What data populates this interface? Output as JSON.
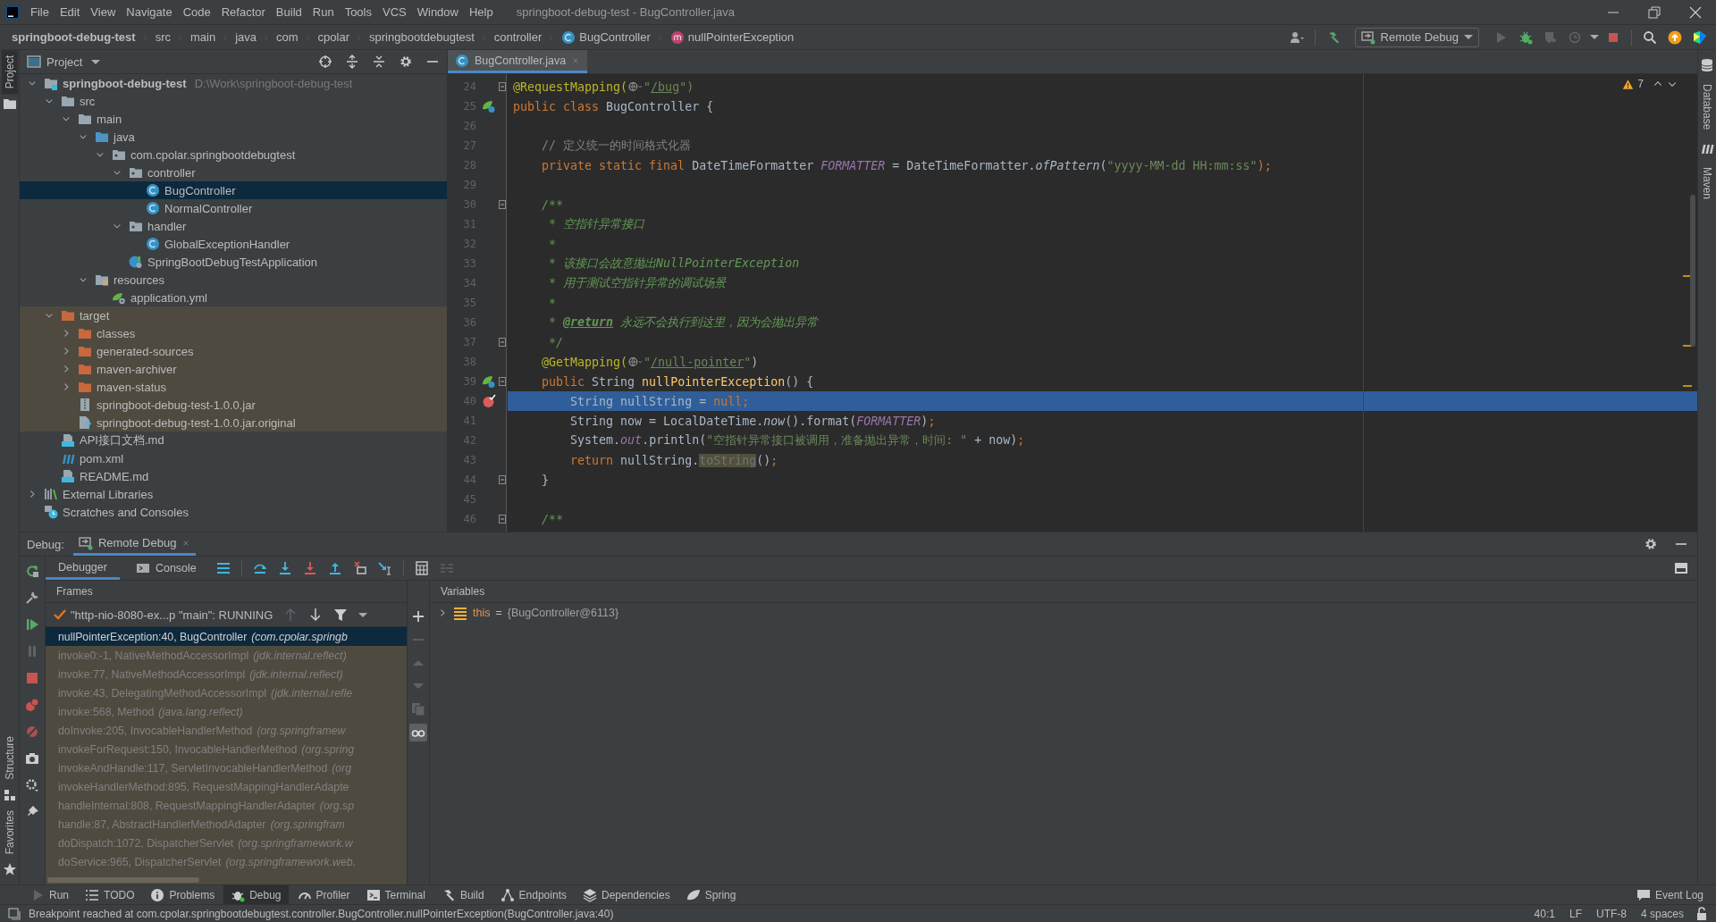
{
  "window": {
    "title": "springboot-debug-test - BugController.java"
  },
  "menu": [
    "File",
    "Edit",
    "View",
    "Navigate",
    "Code",
    "Refactor",
    "Build",
    "Run",
    "Tools",
    "VCS",
    "Window",
    "Help"
  ],
  "breadcrumbs": [
    {
      "label": "springboot-debug-test",
      "kind": "project"
    },
    {
      "label": "src",
      "kind": "folder"
    },
    {
      "label": "main",
      "kind": "folder"
    },
    {
      "label": "java",
      "kind": "folder"
    },
    {
      "label": "com",
      "kind": "folder"
    },
    {
      "label": "cpolar",
      "kind": "folder"
    },
    {
      "label": "springbootdebugtest",
      "kind": "folder"
    },
    {
      "label": "controller",
      "kind": "folder"
    },
    {
      "label": "BugController",
      "kind": "class"
    },
    {
      "label": "nullPointerException",
      "kind": "method"
    }
  ],
  "run_config": {
    "label": "Remote Debug"
  },
  "left_stripe": [
    {
      "label": "Project",
      "selected": true
    },
    {
      "label": "Structure",
      "selected": false
    },
    {
      "label": "Favorites",
      "selected": false
    }
  ],
  "right_stripe": [
    {
      "label": "Database",
      "kind": "database"
    },
    {
      "label": "Maven",
      "kind": "maven"
    }
  ],
  "project_panel": {
    "title": "Project",
    "tree": [
      {
        "name": "springboot-debug-test",
        "path": "D:\\Work\\springboot-debug-test",
        "kind": "module",
        "expanded": true,
        "selected": false,
        "children": [
          {
            "name": "src",
            "kind": "folder",
            "expanded": true,
            "selected": false,
            "excluded": false,
            "children": [
              {
                "name": "main",
                "kind": "folder",
                "expanded": true,
                "selected": false,
                "children": [
                  {
                    "name": "java",
                    "kind": "source-root",
                    "expanded": true,
                    "selected": false,
                    "children": [
                      {
                        "name": "com.cpolar.springbootdebugtest",
                        "kind": "package",
                        "expanded": true,
                        "selected": false,
                        "children": [
                          {
                            "name": "controller",
                            "kind": "package",
                            "expanded": true,
                            "selected": false,
                            "children": [
                              {
                                "name": "BugController",
                                "kind": "class",
                                "selected": true
                              },
                              {
                                "name": "NormalController",
                                "kind": "class",
                                "selected": false
                              }
                            ]
                          },
                          {
                            "name": "handler",
                            "kind": "package",
                            "expanded": true,
                            "selected": false,
                            "children": [
                              {
                                "name": "GlobalExceptionHandler",
                                "kind": "class",
                                "selected": false
                              }
                            ]
                          },
                          {
                            "name": "SpringBootDebugTestApplication",
                            "kind": "spring-app",
                            "selected": false
                          }
                        ]
                      }
                    ]
                  },
                  {
                    "name": "resources",
                    "kind": "resources-root",
                    "expanded": true,
                    "selected": false,
                    "children": [
                      {
                        "name": "application.yml",
                        "kind": "yml",
                        "selected": false
                      }
                    ]
                  }
                ]
              }
            ]
          },
          {
            "name": "target",
            "kind": "excluded-folder",
            "expanded": true,
            "selected": false,
            "excluded": true,
            "children": [
              {
                "name": "classes",
                "kind": "excluded-folder",
                "expanded": false,
                "selected": false
              },
              {
                "name": "generated-sources",
                "kind": "excluded-folder",
                "expanded": false,
                "selected": false
              },
              {
                "name": "maven-archiver",
                "kind": "excluded-folder",
                "expanded": false,
                "selected": false
              },
              {
                "name": "maven-status",
                "kind": "excluded-folder",
                "expanded": false,
                "selected": false
              },
              {
                "name": "springboot-debug-test-1.0.0.jar",
                "kind": "jar",
                "selected": false
              },
              {
                "name": "springboot-debug-test-1.0.0.jar.original",
                "kind": "unknown",
                "selected": false
              }
            ]
          },
          {
            "name": "API接口文档.md",
            "kind": "markdown",
            "selected": false,
            "excluded": false
          },
          {
            "name": "pom.xml",
            "kind": "maven",
            "selected": false,
            "excluded": false
          },
          {
            "name": "README.md",
            "kind": "markdown",
            "selected": false,
            "excluded": false
          }
        ]
      },
      {
        "name": "External Libraries",
        "kind": "libraries",
        "expanded": false,
        "selected": false
      },
      {
        "name": "Scratches and Consoles",
        "kind": "scratches",
        "selected": false
      }
    ]
  },
  "editor": {
    "tabs": [
      {
        "label": "BugController.java",
        "selected": true
      }
    ],
    "warnings": "7",
    "lines": [
      {
        "number": "24",
        "fold": true,
        "current": false,
        "tokens": [
          {
            "text": "@RequestMapping(",
            "kind": "ann"
          },
          {
            "kind": "globe"
          },
          {
            "text": "\"",
            "kind": "str"
          },
          {
            "text": "/bug",
            "kind": "link"
          },
          {
            "text": "\")",
            "kind": "str"
          }
        ]
      },
      {
        "number": "25",
        "runnable": true,
        "fold": false,
        "current": false,
        "tokens": [
          {
            "text": "public class ",
            "kind": "kw"
          },
          {
            "text": "BugController {",
            "kind": "plain"
          }
        ]
      },
      {
        "number": "26",
        "fold": false,
        "current": false
      },
      {
        "number": "27",
        "fold": false,
        "current": false,
        "tokens": [
          {
            "text": "    // 定义统一的时间格式化器",
            "kind": "com"
          }
        ]
      },
      {
        "number": "28",
        "fold": false,
        "current": false,
        "tokens": [
          {
            "text": "    private static final ",
            "kind": "kw"
          },
          {
            "text": "DateTimeFormatter ",
            "kind": "plain"
          },
          {
            "text": "FORMATTER",
            "kind": "field"
          },
          {
            "text": " = DateTimeFormatter.",
            "kind": "plain"
          },
          {
            "text": "ofPattern",
            "kind": "italic"
          },
          {
            "text": "(",
            "kind": "plain"
          },
          {
            "text": "\"yyyy-MM-dd HH:mm:ss\"",
            "kind": "str"
          },
          {
            "text": ");",
            "kind": "kw"
          }
        ]
      },
      {
        "number": "29",
        "fold": false,
        "current": false
      },
      {
        "number": "30",
        "fold": true,
        "current": false,
        "tokens": [
          {
            "text": "    /**",
            "kind": "doc"
          }
        ]
      },
      {
        "number": "31",
        "fold": false,
        "current": false,
        "tokens": [
          {
            "text": "     * 空指针异常接口",
            "kind": "doc"
          }
        ]
      },
      {
        "number": "32",
        "fold": false,
        "current": false,
        "tokens": [
          {
            "text": "     *",
            "kind": "doc"
          }
        ]
      },
      {
        "number": "33",
        "fold": false,
        "current": false,
        "tokens": [
          {
            "text": "     * 该接口会故意抛出NullPointerException",
            "kind": "doc"
          }
        ]
      },
      {
        "number": "34",
        "fold": false,
        "current": false,
        "tokens": [
          {
            "text": "     * 用于测试空指针异常的调试场景",
            "kind": "doc"
          }
        ]
      },
      {
        "number": "35",
        "fold": false,
        "current": false,
        "tokens": [
          {
            "text": "     *",
            "kind": "doc"
          }
        ]
      },
      {
        "number": "36",
        "fold": false,
        "current": false,
        "tokens": [
          {
            "text": "     * ",
            "kind": "doc"
          },
          {
            "text": "@return",
            "kind": "doctag"
          },
          {
            "text": " 永远不会执行到这里，因为会抛出异常",
            "kind": "doc"
          }
        ]
      },
      {
        "number": "37",
        "fold": true,
        "current": false,
        "tokens": [
          {
            "text": "     */",
            "kind": "doc"
          }
        ]
      },
      {
        "number": "38",
        "fold": false,
        "current": false,
        "tokens": [
          {
            "text": "    @GetMapping(",
            "kind": "ann"
          },
          {
            "kind": "globe"
          },
          {
            "text": "\"",
            "kind": "str"
          },
          {
            "text": "/null-pointer",
            "kind": "link"
          },
          {
            "text": "\"",
            "kind": "str"
          },
          {
            "text": ")",
            "kind": "plain"
          }
        ]
      },
      {
        "number": "39",
        "runnable": true,
        "fold": true,
        "current": false,
        "tokens": [
          {
            "text": "    public ",
            "kind": "kw"
          },
          {
            "text": "String ",
            "kind": "plain"
          },
          {
            "text": "nullPointerException",
            "kind": "decl"
          },
          {
            "text": "() {",
            "kind": "plain"
          }
        ]
      },
      {
        "number": "40",
        "breakpoint": true,
        "fold": false,
        "current": true,
        "tokens": [
          {
            "text": "        String nullString = ",
            "kind": "plain"
          },
          {
            "text": "null;",
            "kind": "kw"
          }
        ]
      },
      {
        "number": "41",
        "fold": false,
        "current": false,
        "tokens": [
          {
            "text": "        String now = LocalDateTime.",
            "kind": "plain"
          },
          {
            "text": "now",
            "kind": "italic"
          },
          {
            "text": "().format(",
            "kind": "plain"
          },
          {
            "text": "FORMATTER",
            "kind": "field"
          },
          {
            "text": ")",
            "kind": "plain"
          },
          {
            "text": ";",
            "kind": "kw"
          }
        ]
      },
      {
        "number": "42",
        "fold": false,
        "current": false,
        "tokens": [
          {
            "text": "        System.",
            "kind": "plain"
          },
          {
            "text": "out",
            "kind": "field"
          },
          {
            "text": ".println(",
            "kind": "plain"
          },
          {
            "text": "\"空指针异常接口被调用，准备抛出异常，时间: \"",
            "kind": "str"
          },
          {
            "text": " + now)",
            "kind": "plain"
          },
          {
            "text": ";",
            "kind": "kw"
          }
        ]
      },
      {
        "number": "43",
        "fold": false,
        "current": false,
        "tokens": [
          {
            "text": "        return ",
            "kind": "kw"
          },
          {
            "text": "nullString.",
            "kind": "plain"
          },
          {
            "text": "toString",
            "kind": "hl"
          },
          {
            "text": "()",
            "kind": "plain"
          },
          {
            "text": ";",
            "kind": "kw"
          }
        ]
      },
      {
        "number": "44",
        "fold": true,
        "current": false,
        "tokens": [
          {
            "text": "    }",
            "kind": "plain"
          }
        ]
      },
      {
        "number": "45",
        "fold": false,
        "current": false
      },
      {
        "number": "46",
        "fold": true,
        "current": false,
        "tokens": [
          {
            "text": "    /**",
            "kind": "doc"
          }
        ]
      }
    ]
  },
  "debug": {
    "title": "Debug:",
    "sessions": [
      {
        "label": "Remote Debug",
        "selected": true
      }
    ],
    "tabs": [
      {
        "label": "Debugger",
        "selected": true
      },
      {
        "label": "Console",
        "selected": false
      }
    ],
    "frames_title": "Frames",
    "thread": "\"http-nio-8080-ex...p \"main\": RUNNING",
    "frames": [
      {
        "text": "nullPointerException:40, BugController",
        "package": "(com.cpolar.springb",
        "selected": true
      },
      {
        "text": "invoke0:-1, NativeMethodAccessorImpl",
        "package": "(jdk.internal.reflect)",
        "selected": false
      },
      {
        "text": "invoke:77, NativeMethodAccessorImpl",
        "package": "(jdk.internal.reflect)",
        "selected": false
      },
      {
        "text": "invoke:43, DelegatingMethodAccessorImpl",
        "package": "(jdk.internal.refle",
        "selected": false
      },
      {
        "text": "invoke:568, Method",
        "package": "(java.lang.reflect)",
        "selected": false
      },
      {
        "text": "doInvoke:205, InvocableHandlerMethod",
        "package": "(org.springframew",
        "selected": false
      },
      {
        "text": "invokeForRequest:150, InvocableHandlerMethod",
        "package": "(org.spring",
        "selected": false
      },
      {
        "text": "invokeAndHandle:117, ServletInvocableHandlerMethod",
        "package": "(org",
        "selected": false
      },
      {
        "text": "invokeHandlerMethod:895, RequestMappingHandlerAdapte",
        "selected": false
      },
      {
        "text": "handleInternal:808, RequestMappingHandlerAdapter",
        "package": "(org.sp",
        "selected": false
      },
      {
        "text": "handle:87, AbstractHandlerMethodAdapter",
        "package": "(org.springfram",
        "selected": false
      },
      {
        "text": "doDispatch:1072, DispatcherServlet",
        "package": "(org.springframework.w",
        "selected": false
      },
      {
        "text": "doService:965, DispatcherServlet",
        "package": "(org.springframework.web.",
        "selected": false
      }
    ],
    "variables_title": "Variables",
    "variables": [
      {
        "name": "this",
        "separator": "=",
        "value": "{BugController@6113}",
        "expanded": false
      }
    ]
  },
  "tool_windows": [
    {
      "label": "Run",
      "selected": false
    },
    {
      "label": "TODO",
      "selected": false
    },
    {
      "label": "Problems",
      "selected": false
    },
    {
      "label": "Debug",
      "selected": true
    },
    {
      "label": "Profiler",
      "selected": false
    },
    {
      "label": "Terminal",
      "selected": false
    },
    {
      "label": "Build",
      "selected": false
    },
    {
      "label": "Endpoints",
      "selected": false
    },
    {
      "label": "Dependencies",
      "selected": false
    },
    {
      "label": "Spring",
      "selected": false
    }
  ],
  "event_log": "Event Log",
  "status_bar": {
    "message": "Breakpoint reached at com.cpolar.springbootdebugtest.controller.BugController.nullPointerException(BugController.java:40)",
    "position": "40:1",
    "line_ending": "LF",
    "encoding": "UTF-8",
    "indent": "4 spaces"
  }
}
